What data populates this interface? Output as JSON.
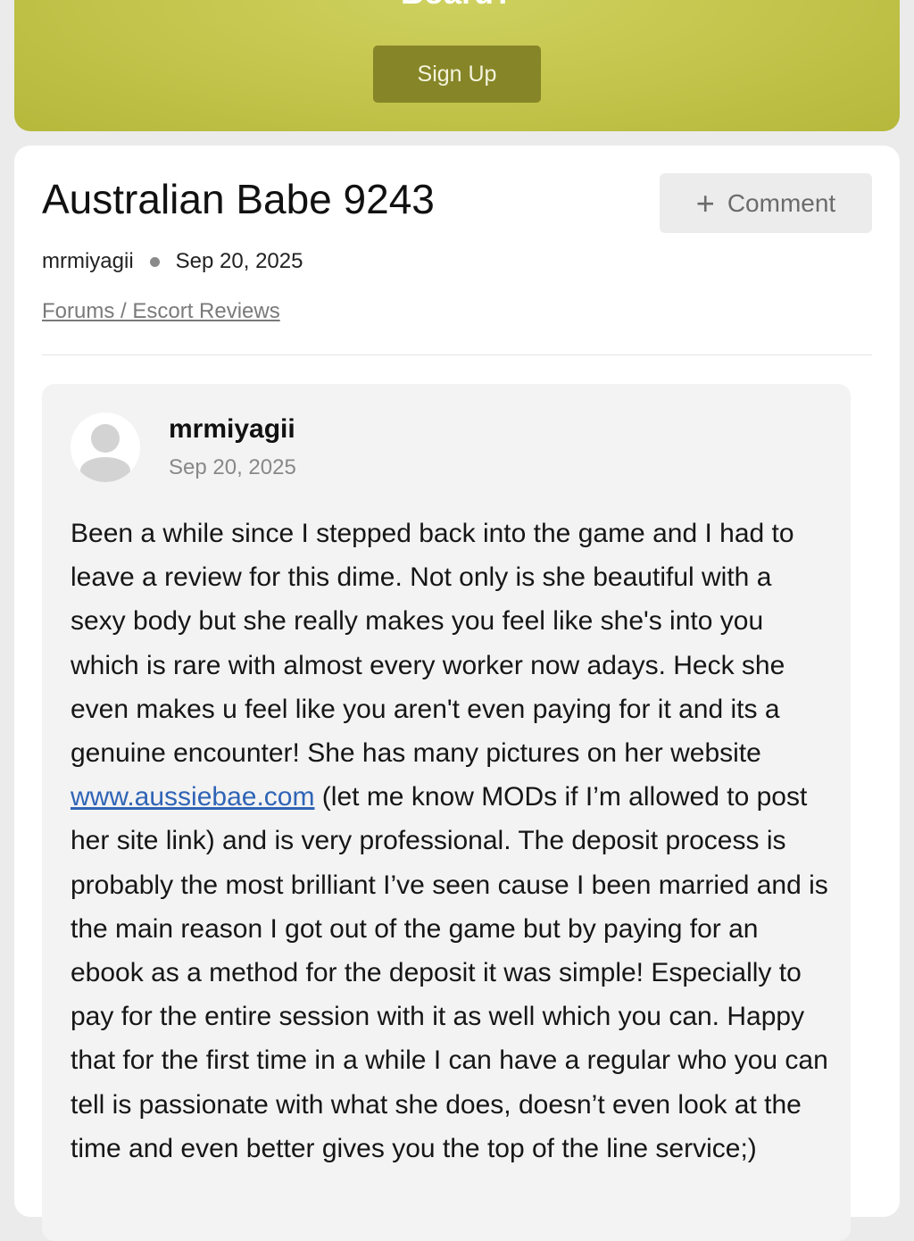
{
  "banner": {
    "title": "Board?",
    "signup_label": "Sign Up"
  },
  "thread": {
    "title": "Australian Babe 9243",
    "comment_label": "Comment",
    "author": "mrmiyagii",
    "date": "Sep 20, 2025",
    "breadcrumb": "Forums / Escort Reviews"
  },
  "post": {
    "author": "mrmiyagii",
    "date": "Sep 20, 2025",
    "body_before_link": "Been a while since I stepped back into the game and I had to leave a review for this dime. Not only is she beautiful with a sexy body but she really makes you feel like she's into you which is rare with almost every worker now adays. Heck she even makes u feel like you aren't even paying for it and its a genuine encounter! She has many pictures on her website ",
    "link_text": "www.aussiebae.com",
    "body_after_link": " (let me know MODs if I’m allowed to post her site link) and is very professional. The deposit process is probably the most brilliant I’ve seen cause I been married and is the main reason I got out of the game but by paying for an ebook as a method for the deposit it was simple! Especially to pay for the entire session with it as well which you can. Happy that for the first time in a while I can have a regular who you can tell is passionate with what she does, doesn’t even look at the time and even better gives you the top of the line service;)"
  },
  "icons": {
    "plus": "plus-icon",
    "avatar": "user-avatar-icon",
    "separator": "dot-separator"
  },
  "colors": {
    "banner": "#c4c64e",
    "signup_button": "#868528",
    "link": "#2f64b6"
  }
}
